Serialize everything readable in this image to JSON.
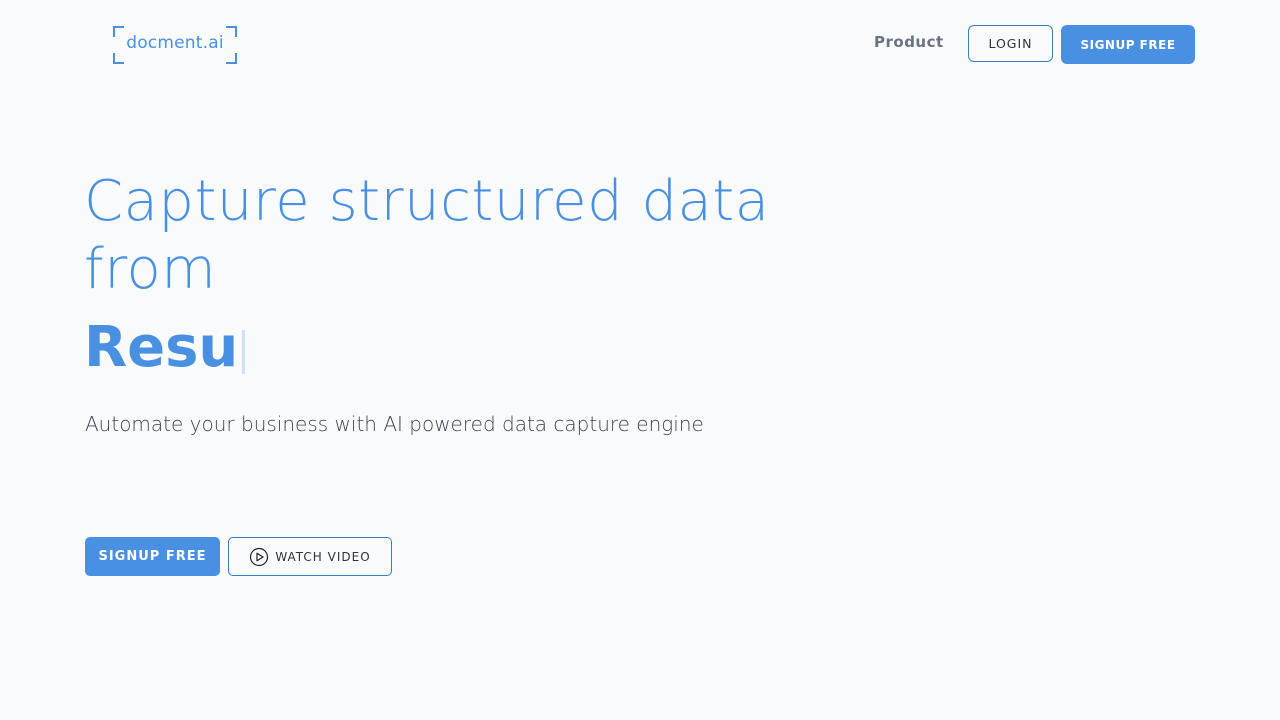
{
  "header": {
    "logo_text": "docment.ai",
    "nav": {
      "product_label": "Product",
      "login_label": "LOGIN",
      "signup_label": "SIGNUP FREE"
    }
  },
  "hero": {
    "title": "Capture structured data from",
    "typed_word": "Resu",
    "subtitle": "Automate your business with AI powered data capture engine",
    "cta": {
      "signup_label": "SIGNUP FREE",
      "watch_label": "WATCH VIDEO",
      "watch_icon": "play-circle-icon"
    }
  },
  "colors": {
    "accent": "#4a90e2",
    "background": "#f8fafc",
    "text": "#3d4451"
  }
}
